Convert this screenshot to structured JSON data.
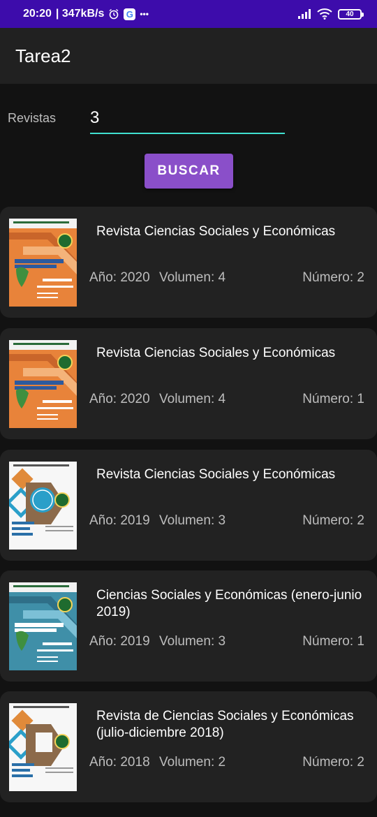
{
  "status_bar": {
    "time": "20:20",
    "speed": "| 347kB/s",
    "battery": "40",
    "more": "•••"
  },
  "app": {
    "title": "Tarea2"
  },
  "search": {
    "label": "Revistas",
    "value": "3",
    "button": "BUSCAR"
  },
  "results": [
    {
      "title": "Revista Ciencias Sociales y Económicas",
      "year": "Año: 2020",
      "volume": "Volumen: 4",
      "number": "Número: 2"
    },
    {
      "title": "Revista Ciencias Sociales y Económicas",
      "year": "Año: 2020",
      "volume": "Volumen: 4",
      "number": "Número: 1"
    },
    {
      "title": "Revista Ciencias Sociales y Económicas",
      "year": "Año: 2019",
      "volume": "Volumen: 3",
      "number": "Número: 2"
    },
    {
      "title": "Ciencias Sociales y Económicas (enero-junio 2019)",
      "year": "Año: 2019",
      "volume": "Volumen: 3",
      "number": "Número: 1"
    },
    {
      "title": "Revista de Ciencias Sociales y Económicas (julio-diciembre 2018)",
      "year": "Año: 2018",
      "volume": "Volumen: 2",
      "number": "Número: 2"
    }
  ],
  "colors": {
    "status_bar": "#3d0cab",
    "app_bar": "#212121",
    "background": "#121212",
    "card": "#222222",
    "accent_button": "#8a4fc9",
    "input_underline": "#40e0d0"
  },
  "icons": [
    "alarm-icon",
    "google-icon",
    "signal-icon",
    "wifi-icon",
    "battery-icon",
    "journal-cover-image"
  ]
}
